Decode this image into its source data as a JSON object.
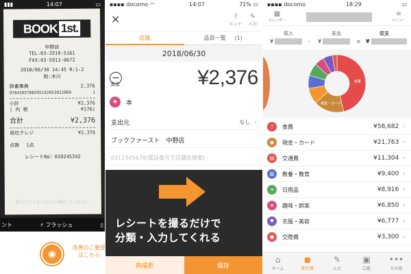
{
  "left_panel": {
    "status_time": "14:07",
    "receipt": {
      "logo_main": "BOOK",
      "logo_accent": "1st.",
      "store": "中野店",
      "tel": "TEL:03-3319-5161",
      "fax": "FAX:03-5913-0672",
      "datetime": "2018/06/30 14:45 R:1-2",
      "staff": "担:木川",
      "item_name": "辞書事典",
      "item_price": "2,376",
      "item_code": "9784305708595192053922009",
      "item_qty": "1",
      "subtotal_label": "小計",
      "subtotal_value": "¥2,376",
      "tax_label": "( 内 税",
      "tax_value": "¥176)",
      "total_label": "合計",
      "total_value": "¥2,376",
      "credit_label": "自社クレジ",
      "credit_value": "¥2,376",
      "count_label": "点数",
      "count_value": "1点",
      "receipt_no": "レシートNo：010245342"
    },
    "scan_note": "影がうつらないように撮影してください",
    "camera_bar_left": "ント",
    "camera_bar_flash": "フラッシュ",
    "suggestion": "改善のご要望はこちら"
  },
  "mid_panel": {
    "status_carrier": "docomo",
    "status_time": "14:07",
    "status_battery": "71%",
    "hint_label": "ヒント",
    "input_label": "入力",
    "tab_store": "店舗",
    "tab_items": "品目一覧",
    "tab_items_count": "(1)",
    "date": "2018/06/30",
    "expense_label": "支出",
    "amount": "¥2,376",
    "category": "本",
    "source_label": "支出元",
    "source_value": "なし",
    "store_name": "ブックファースト　中野店",
    "phone_placeholder": "0312345678(電話番号で店舗名検索)",
    "promo_line1": "レシートを撮るだけで",
    "promo_line2": "分類・入力してくれる",
    "retake_label": "再撮影",
    "save_label": "保存"
  },
  "right_panel": {
    "status_carrier": "docomo",
    "status_time": "18:29",
    "calendar_label": "カレンダー",
    "menu_label": "メニュー",
    "income_label": "収入",
    "expense_label": "支出",
    "balance_label": "収支",
    "yen": "¥",
    "minus": "-",
    "equals": "=",
    "chart_labels": {
      "food": "食費",
      "cash": "現金・カード"
    },
    "items": [
      {
        "name": "食費",
        "value": "¥58,682",
        "icon": "fork-knife-icon",
        "color": "#e54b4b",
        "glyph": "🍴"
      },
      {
        "name": "現金・カード",
        "value": "¥21,763",
        "icon": "wallet-icon",
        "color": "#c9893b",
        "glyph": "▣"
      },
      {
        "name": "交通費",
        "value": "¥11,304",
        "icon": "train-icon",
        "color": "#e0574f",
        "glyph": "▤"
      },
      {
        "name": "教養・教育",
        "value": "¥9,400",
        "icon": "book-icon",
        "color": "#5a6fd0",
        "glyph": "▥"
      },
      {
        "name": "日用品",
        "value": "¥8,916",
        "icon": "leaf-icon",
        "color": "#55a95a",
        "glyph": "❧"
      },
      {
        "name": "趣味・娯楽",
        "value": "¥6,850",
        "icon": "star-icon",
        "color": "#d94d7e",
        "glyph": "★"
      },
      {
        "name": "衣服・美容",
        "value": "¥6,777",
        "icon": "shirt-icon",
        "color": "#7a5bc2",
        "glyph": "♥"
      },
      {
        "name": "交際費",
        "value": "¥3,300",
        "icon": "people-icon",
        "color": "#e0574f",
        "glyph": "●"
      }
    ],
    "nav": [
      "ホーム",
      "家計簿",
      "入力",
      "口座",
      "その他"
    ]
  },
  "chart_data": {
    "type": "pie",
    "categories": [
      "食費",
      "現金・カード",
      "交通費",
      "教養・教育",
      "日用品",
      "趣味・娯楽",
      "衣服・美容",
      "交際費"
    ],
    "values": [
      58682,
      21763,
      11304,
      9400,
      8916,
      6850,
      6777,
      3300
    ],
    "colors": [
      "#e54b4b",
      "#c9893b",
      "#f39530",
      "#5a6fd0",
      "#55a95a",
      "#d94d7e",
      "#7a5bc2",
      "#e0574f"
    ],
    "title": "",
    "xlabel": "",
    "ylabel": ""
  }
}
